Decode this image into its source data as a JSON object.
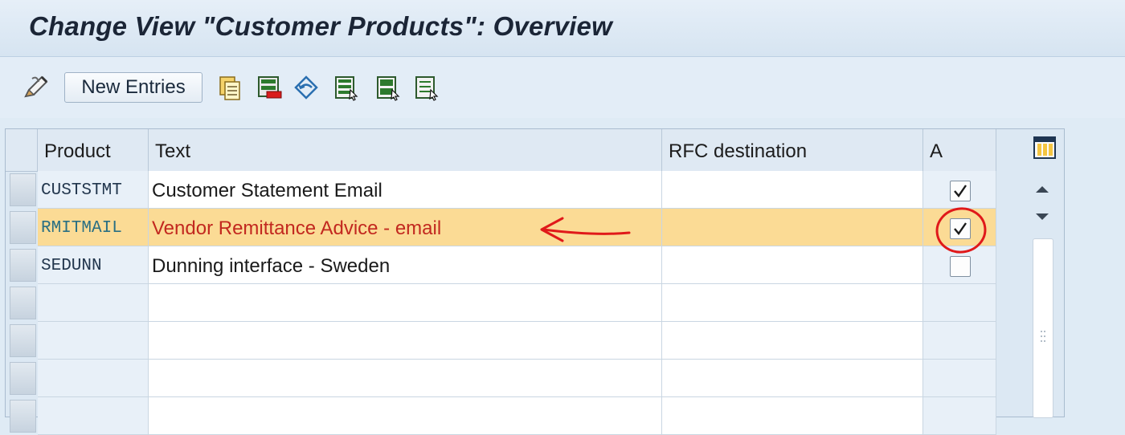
{
  "window": {
    "title": "Change View \"Customer Products\": Overview"
  },
  "toolbar": {
    "new_entries_label": "New Entries",
    "icons": [
      "edit-icon",
      "copy-icon",
      "delete-icon",
      "undo-icon",
      "select-all-icon",
      "select-block-icon",
      "deselect-all-icon"
    ]
  },
  "table": {
    "columns": [
      "Product",
      "Text",
      "RFC destination",
      "A"
    ],
    "rows": [
      {
        "product": "CUSTSTMT",
        "text": "Customer Statement Email",
        "rfc": "",
        "active": true,
        "highlighted": false
      },
      {
        "product": "RMITMAIL",
        "text": "Vendor Remittance Advice - email",
        "rfc": "",
        "active": true,
        "highlighted": true
      },
      {
        "product": "SEDUNN",
        "text": "Dunning interface - Sweden",
        "rfc": "",
        "active": false,
        "highlighted": false
      },
      {
        "product": "",
        "text": "",
        "rfc": "",
        "active": null,
        "highlighted": false
      },
      {
        "product": "",
        "text": "",
        "rfc": "",
        "active": null,
        "highlighted": false
      },
      {
        "product": "",
        "text": "",
        "rfc": "",
        "active": null,
        "highlighted": false
      },
      {
        "product": "",
        "text": "",
        "rfc": "",
        "active": null,
        "highlighted": false
      }
    ]
  },
  "colors": {
    "highlight_row": "#fbdb95",
    "highlight_text": "#c2281f",
    "annotation_red": "#e0191a"
  }
}
